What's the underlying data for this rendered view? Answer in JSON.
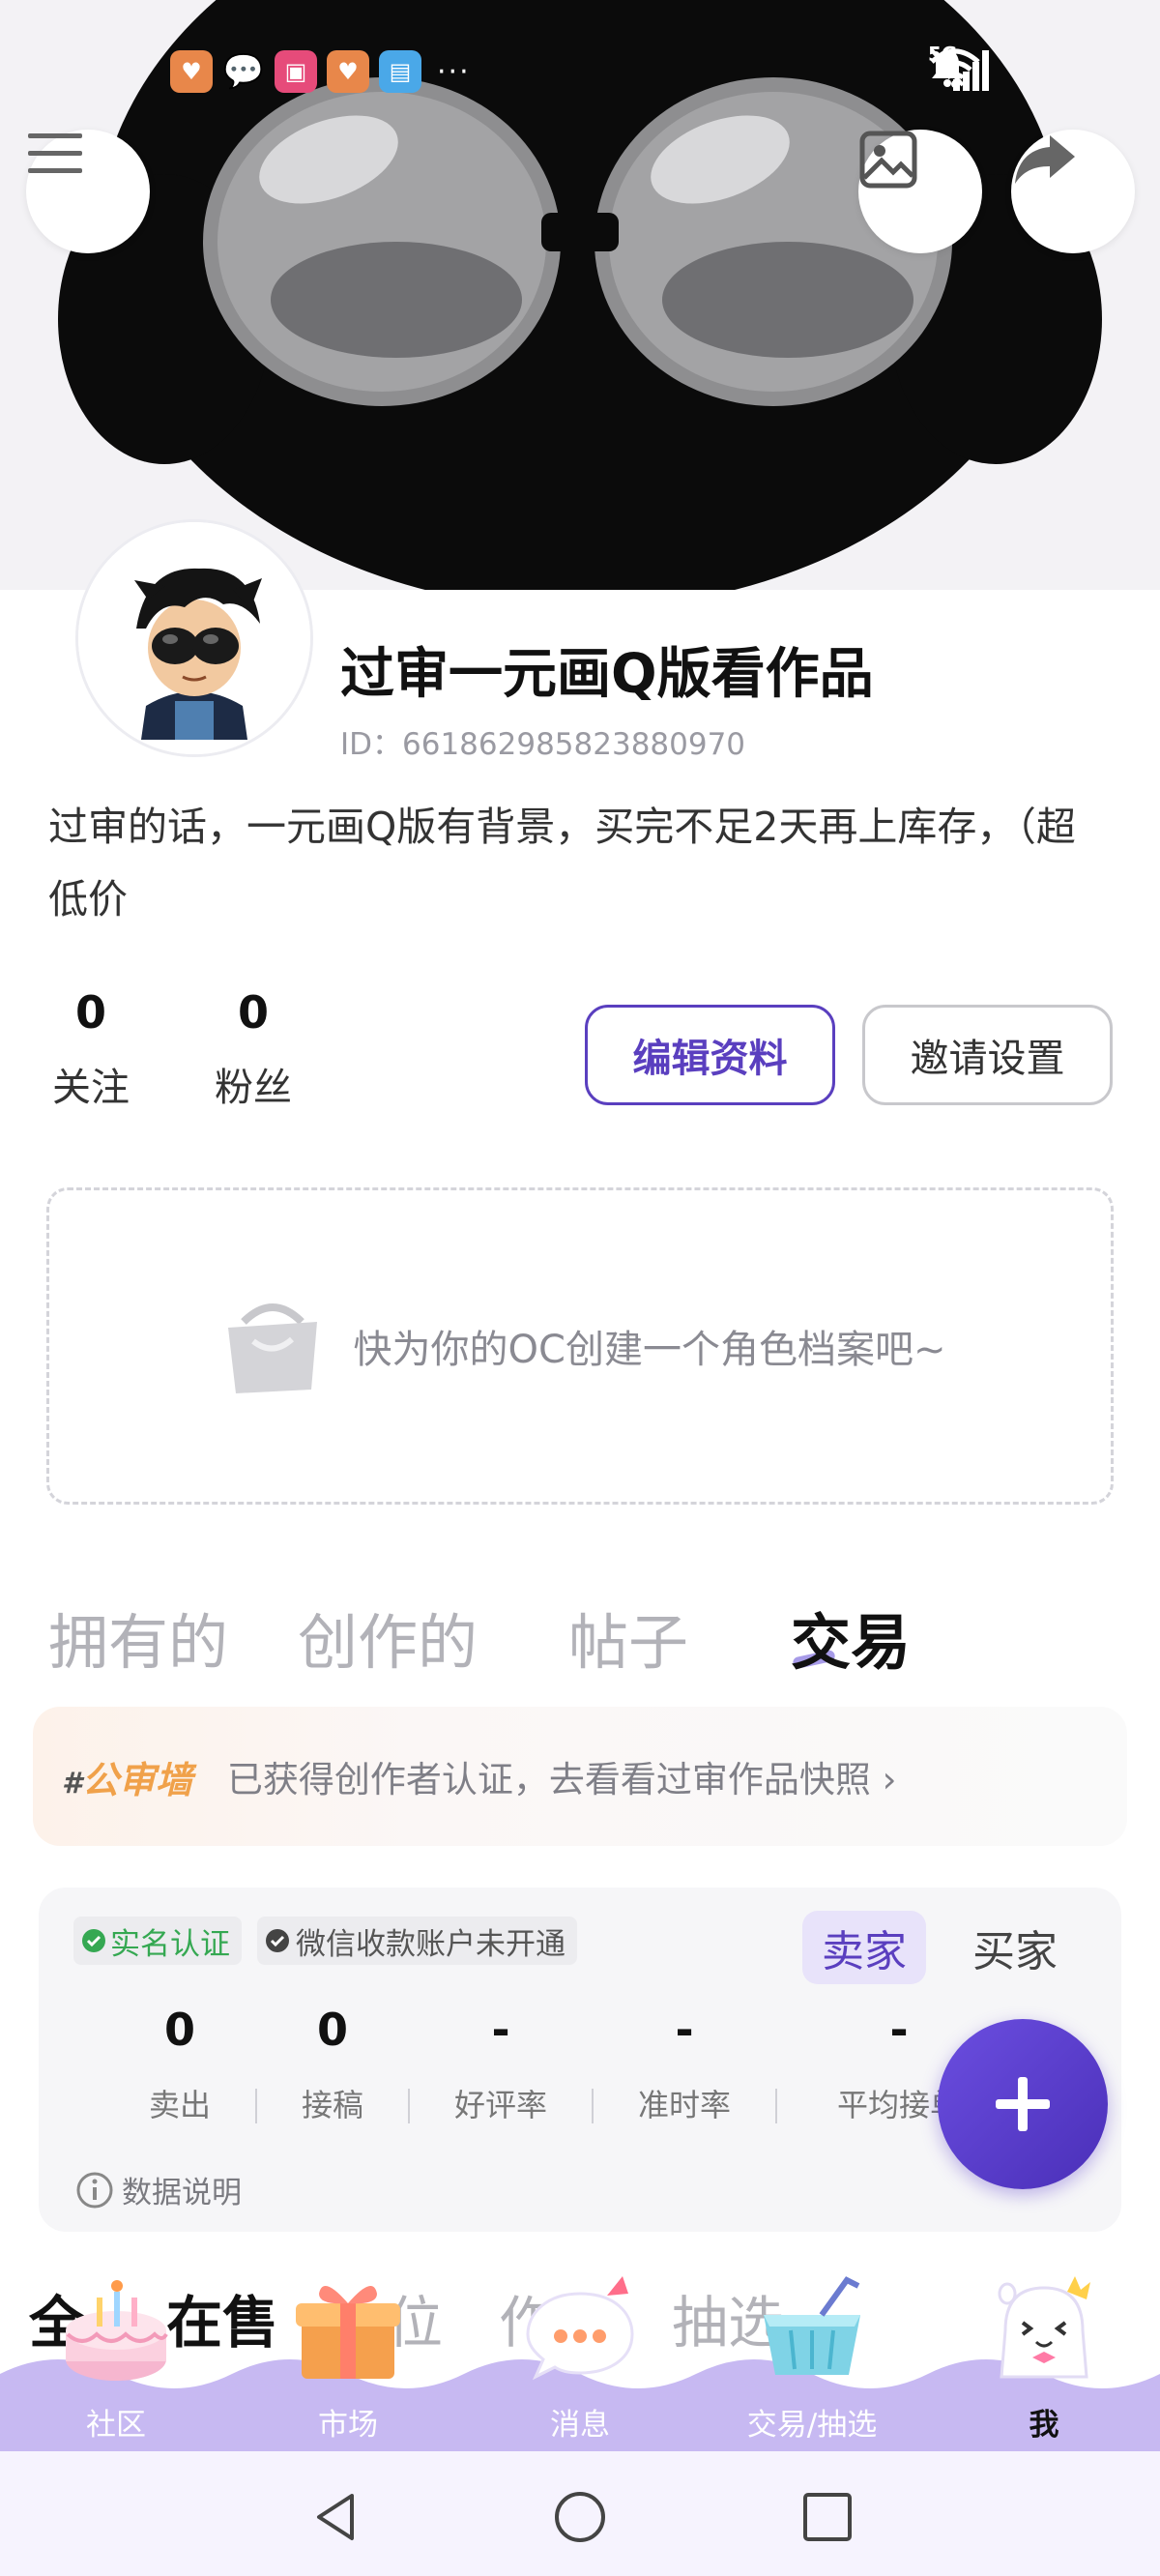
{
  "status_bar": {
    "more_indicator": "···",
    "network": "5G"
  },
  "header": {
    "menu_icon": "hamburger-menu-icon",
    "cover_icon": "image-icon",
    "share_icon": "share-arrow-icon"
  },
  "profile": {
    "nickname": "过审一元画Q版看作品",
    "user_id": "ID：661862985823880970",
    "bio": "过审的话，一元画Q版有背景，买完不足2天再上库存，（超低价",
    "following_count": "0",
    "following_label": "关注",
    "fans_count": "0",
    "fans_label": "粉丝",
    "edit_button": "编辑资料",
    "invite_button": "邀请设置"
  },
  "oc_prompt": {
    "text": "快为你的OC创建一个角色档案吧~"
  },
  "tabs": [
    {
      "label": "拥有的",
      "active": false
    },
    {
      "label": "创作的",
      "active": false
    },
    {
      "label": "帖子",
      "active": false
    },
    {
      "label": "交易",
      "active": true
    }
  ],
  "cert_bar": {
    "logo_hash": "#",
    "logo_text": "公审墙",
    "text": "已获得创作者认证，去看看过审作品快照 ›"
  },
  "trade_card": {
    "badge_real_name": "实名认证",
    "badge_wechat": "微信收款账户未开通",
    "role_seller": "卖家",
    "role_buyer": "买家",
    "stats": [
      {
        "value": "0",
        "label": "卖出"
      },
      {
        "value": "0",
        "label": "接稿"
      },
      {
        "value": "-",
        "label": "好评率"
      },
      {
        "value": "-",
        "label": "准时率"
      },
      {
        "value": "-",
        "label": "平均接单"
      }
    ],
    "data_note": "数据说明"
  },
  "sub_tabs": [
    {
      "label": "全部",
      "visible_part": "全"
    },
    {
      "label": "在售"
    },
    {
      "label": "位"
    },
    {
      "label": "作"
    },
    {
      "label": "抽选"
    }
  ],
  "bottom_nav": [
    {
      "label": "社区",
      "icon": "cake-icon"
    },
    {
      "label": "市场",
      "icon": "gift-box-icon"
    },
    {
      "label": "消息",
      "icon": "chat-bubble-icon"
    },
    {
      "label": "交易/抽选",
      "icon": "shopping-basket-icon"
    },
    {
      "label": "我",
      "icon": "mascot-icon",
      "active": true
    }
  ],
  "colors": {
    "accent": "#5a3fbf",
    "nav_bg": "#c7b9f2",
    "fab": "#5a3fbf",
    "verified_green": "#35a852"
  }
}
